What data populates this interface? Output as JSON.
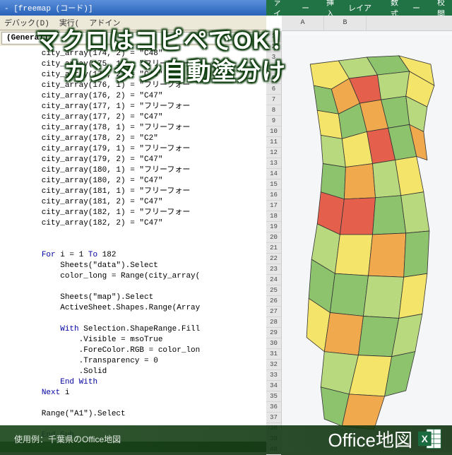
{
  "vba": {
    "title": "- [freemap (コード)]",
    "toolbar": [
      "デバック(D)",
      "実行(",
      "アドイン"
    ],
    "header": "(General)",
    "code_lines": [
      "city_array(174, 2) = \"C48\"",
      "city_array(175, 1) = \"フリーフォー",
      "city_array(175, 2) = \"C46\"",
      "city_array(176, 1) = \"フリーフォー",
      "city_array(176, 2) = \"C47\"",
      "city_array(177, 1) = \"フリーフォー",
      "city_array(177, 2) = \"C47\"",
      "city_array(178, 1) = \"フリーフォー",
      "city_array(178, 2) = \"C2\"",
      "city_array(179, 1) = \"フリーフォー",
      "city_array(179, 2) = \"C47\"",
      "city_array(180, 1) = \"フリーフォー",
      "city_array(180, 2) = \"C47\"",
      "city_array(181, 1) = \"フリーフォー",
      "city_array(181, 2) = \"C47\"",
      "city_array(182, 1) = \"フリーフォー",
      "city_array(182, 2) = \"C47\"",
      "",
      "",
      "For i = 1 To 182",
      "    Sheets(\"data\").Select",
      "    color_long = Range(city_array(",
      "",
      "    Sheets(\"map\").Select",
      "    ActiveSheet.Shapes.Range(Array",
      "",
      "    With Selection.ShapeRange.Fill",
      "        .Visible = msoTrue",
      "        .ForeColor.RGB = color_lon",
      "        .Transparency = 0",
      "        .Solid",
      "    End With",
      "Next i",
      "",
      "Range(\"A1\").Select",
      "",
      "End Sub"
    ]
  },
  "excel": {
    "tabs": [
      "ファイル",
      "ホーム",
      "挿入",
      "ページレイアウト",
      "数式",
      "データ",
      "校閲"
    ],
    "col_headers": [
      "A",
      "B"
    ],
    "row_start": 1,
    "row_end": 40
  },
  "overlays": {
    "line1": "マクロはコピペでOK！",
    "line2": "カンタン自動塗分け"
  },
  "footer": {
    "left": "使用例：千葉県のOffice地図",
    "right": "Office地図"
  },
  "map": {
    "colors": {
      "g1": "#8ec36e",
      "g2": "#b9d97e",
      "y": "#f4e46a",
      "o": "#f0a94d",
      "r": "#e4604c",
      "sea": "#f5f6f7"
    }
  }
}
